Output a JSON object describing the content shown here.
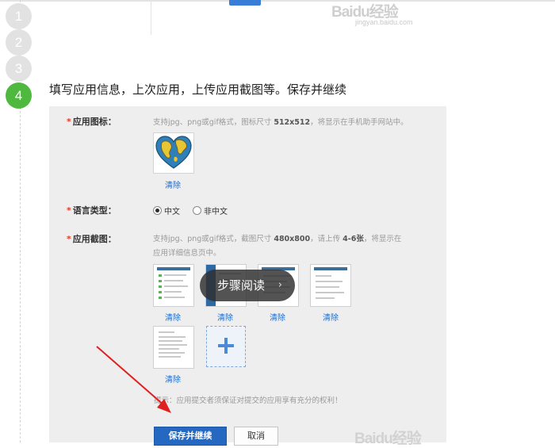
{
  "steps": [
    {
      "number": "1",
      "active": false
    },
    {
      "number": "2",
      "active": false
    },
    {
      "number": "3",
      "active": false
    },
    {
      "number": "4",
      "active": true
    }
  ],
  "watermark": {
    "brand": "Baidu经验",
    "url": "jingyan.baidu.com"
  },
  "step_title": "填写应用信息，上次应用，上传应用截图等。保存并继续",
  "form": {
    "app_icon": {
      "star": "*",
      "label": "应用图标：",
      "hint_prefix": "支持jpg、png或gif格式，图标尺寸",
      "hint_size": "512x512",
      "hint_suffix": "，将显示在手机助手网站中。",
      "remove": "清除"
    },
    "language": {
      "star": "*",
      "label": "语言类型：",
      "options": [
        {
          "label": "中文",
          "checked": true
        },
        {
          "label": "非中文",
          "checked": false
        }
      ]
    },
    "screenshots": {
      "star": "*",
      "label": "应用截图：",
      "hint_prefix": "支持jpg、png或gif格式，截图尺寸",
      "hint_size": "480x800",
      "hint_mid": "，请上传",
      "hint_count": "4-6张",
      "hint_suffix": "，将显示在",
      "hint_line2": "应用详细信息页中。",
      "remove": "清除"
    },
    "notice": "提示：应用提交者须保证对提交的应用享有充分的权利！",
    "save_button": "保存并继续",
    "cancel_button": "取消"
  },
  "overlay": {
    "label": "步骤阅读",
    "chevron": "›"
  },
  "colors": {
    "active_step": "#4eb83f",
    "primary_button": "#2468c2",
    "required_star": "#e23b2b",
    "link": "#1c6cd0"
  }
}
